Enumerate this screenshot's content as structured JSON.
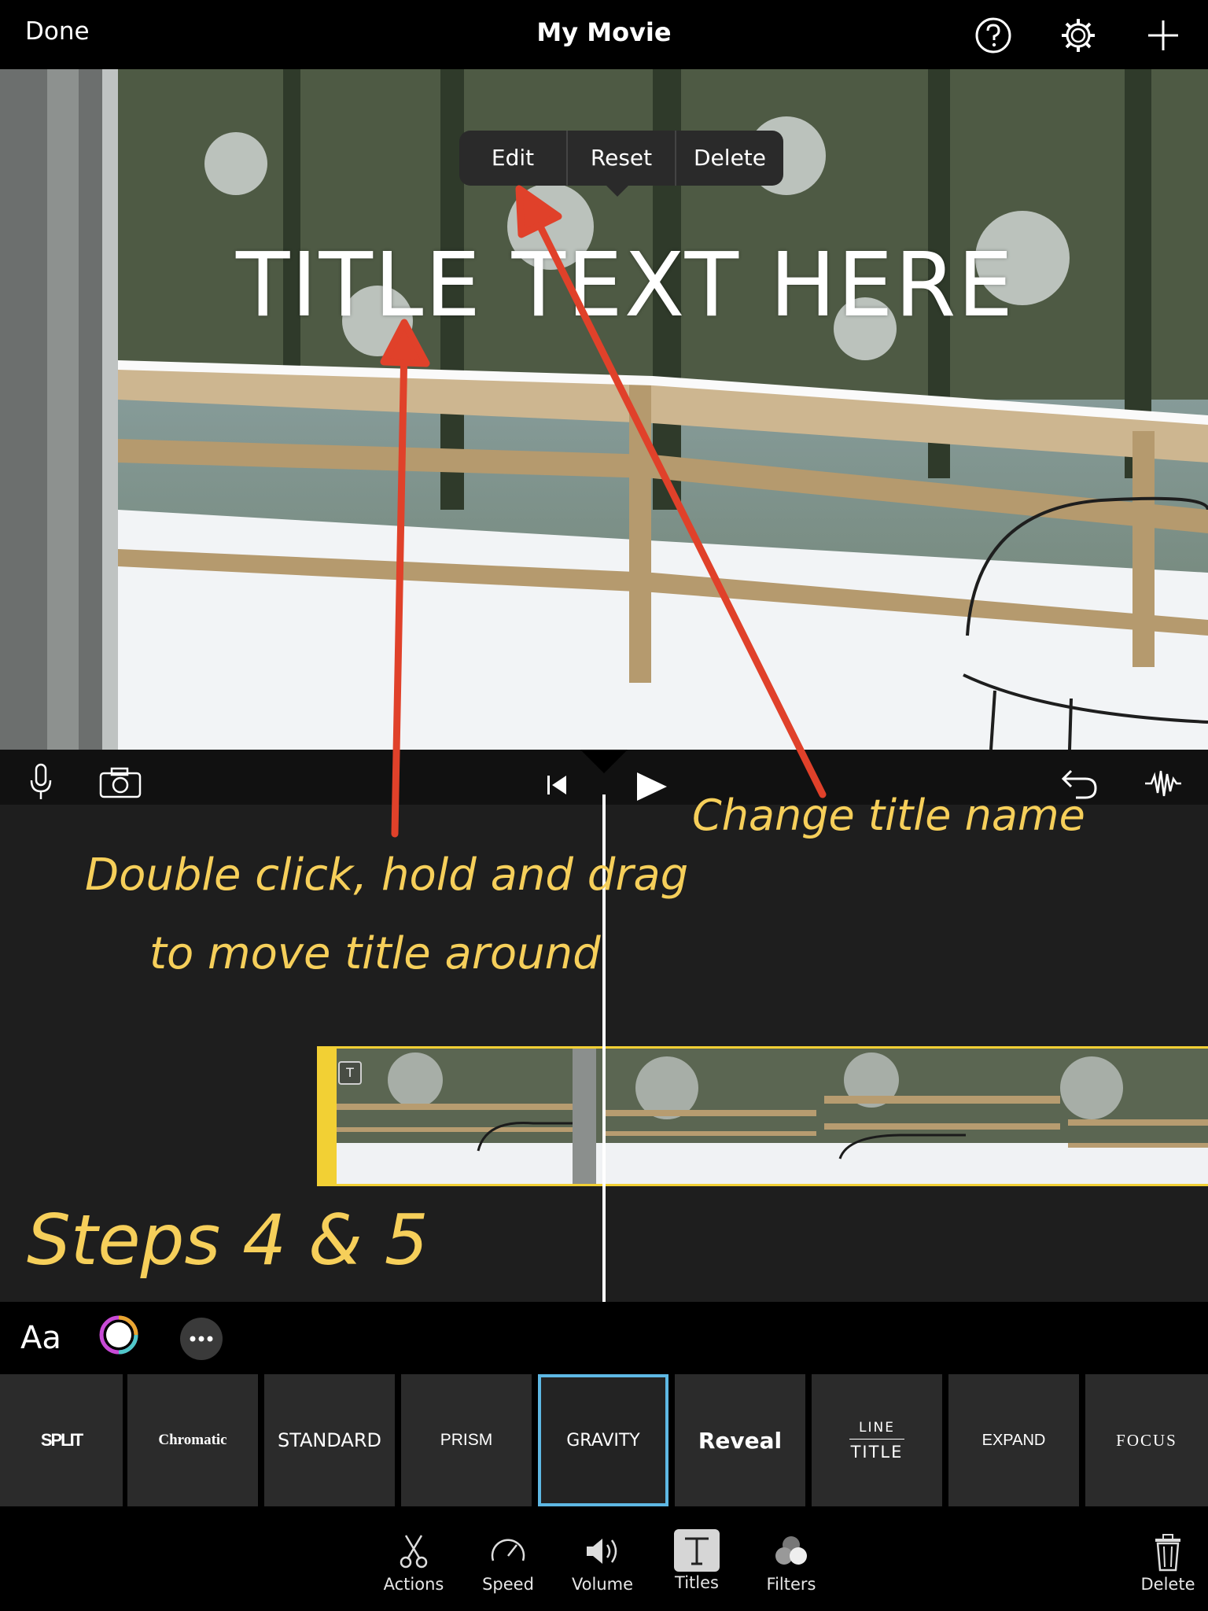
{
  "header": {
    "done_label": "Done",
    "title": "My Movie"
  },
  "icons": {
    "help": "help-circle-icon",
    "settings": "gear-icon",
    "add": "plus-icon"
  },
  "preview": {
    "title_overlay": "TITLE TEXT HERE",
    "context_menu": [
      "Edit",
      "Reset",
      "Delete"
    ]
  },
  "annotations": {
    "change_title": "Change title name",
    "drag_line1": "Double click, hold and drag",
    "drag_line2": "to move title around",
    "steps": "Steps 4 & 5",
    "color": "#f6cf5a",
    "arrow_color": "#e0412a"
  },
  "title_styles": {
    "aa_label": "Aa",
    "items": [
      "SPLIT",
      "Chromatic",
      "STANDARD",
      "PRISM",
      "GRAVITY",
      "Reveal",
      "LINE",
      "TITLE",
      "EXPAND",
      "FOCUS"
    ],
    "selected": "GRAVITY",
    "selected_color": "#5eb8e4"
  },
  "toolbar": {
    "actions": "Actions",
    "speed": "Speed",
    "volume": "Volume",
    "titles": "Titles",
    "filters": "Filters",
    "delete": "Delete"
  },
  "clip": {
    "badge": "T",
    "accent": "#f2d034"
  }
}
